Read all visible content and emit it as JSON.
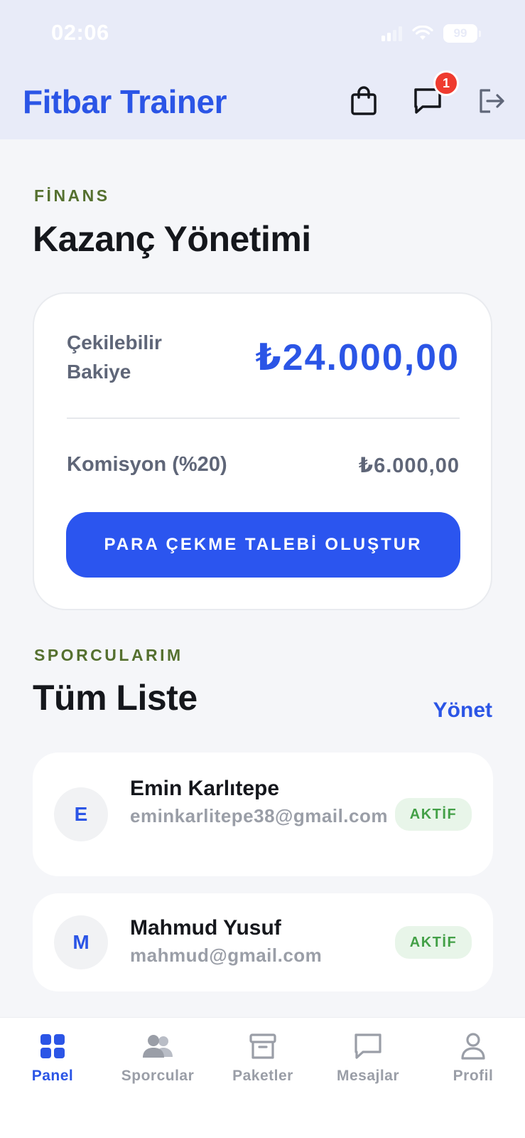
{
  "status_bar": {
    "time": "02:06",
    "battery": "99"
  },
  "header": {
    "title": "Fitbar Trainer",
    "message_badge": "1",
    "icons": [
      "shopping-bag-icon",
      "chat-icon",
      "logout-icon"
    ]
  },
  "finance": {
    "eyebrow": "FİNANS",
    "title": "Kazanç Yönetimi",
    "balance_label": "Çekilebilir Bakiye",
    "balance_value": "₺24.000,00",
    "commission_label": "Komisyon (%20)",
    "commission_value": "₺6.000,00",
    "withdraw_button": "PARA ÇEKME TALEBİ OLUŞTUR"
  },
  "athletes": {
    "eyebrow": "SPORCULARIM",
    "title": "Tüm Liste",
    "manage_link": "Yönet",
    "items": [
      {
        "initial": "E",
        "name": "Emin Karlıtepe",
        "email": "eminkarlitepe38@gmail.com",
        "status": "AKTİF"
      },
      {
        "initial": "M",
        "name": "Mahmud Yusuf",
        "email": "mahmud@gmail.com",
        "status": "AKTİF"
      }
    ]
  },
  "tabs": [
    {
      "label": "Panel",
      "icon": "grid-icon",
      "active": true
    },
    {
      "label": "Sporcular",
      "icon": "users-icon",
      "active": false
    },
    {
      "label": "Paketler",
      "icon": "archive-box-icon",
      "active": false
    },
    {
      "label": "Mesajlar",
      "icon": "chat-icon",
      "active": false
    },
    {
      "label": "Profil",
      "icon": "user-icon",
      "active": false
    }
  ],
  "colors": {
    "accent": "#2b55e6",
    "eyebrow": "#55702f",
    "badge": "#ef3b2f",
    "status_active": "#43a047"
  }
}
